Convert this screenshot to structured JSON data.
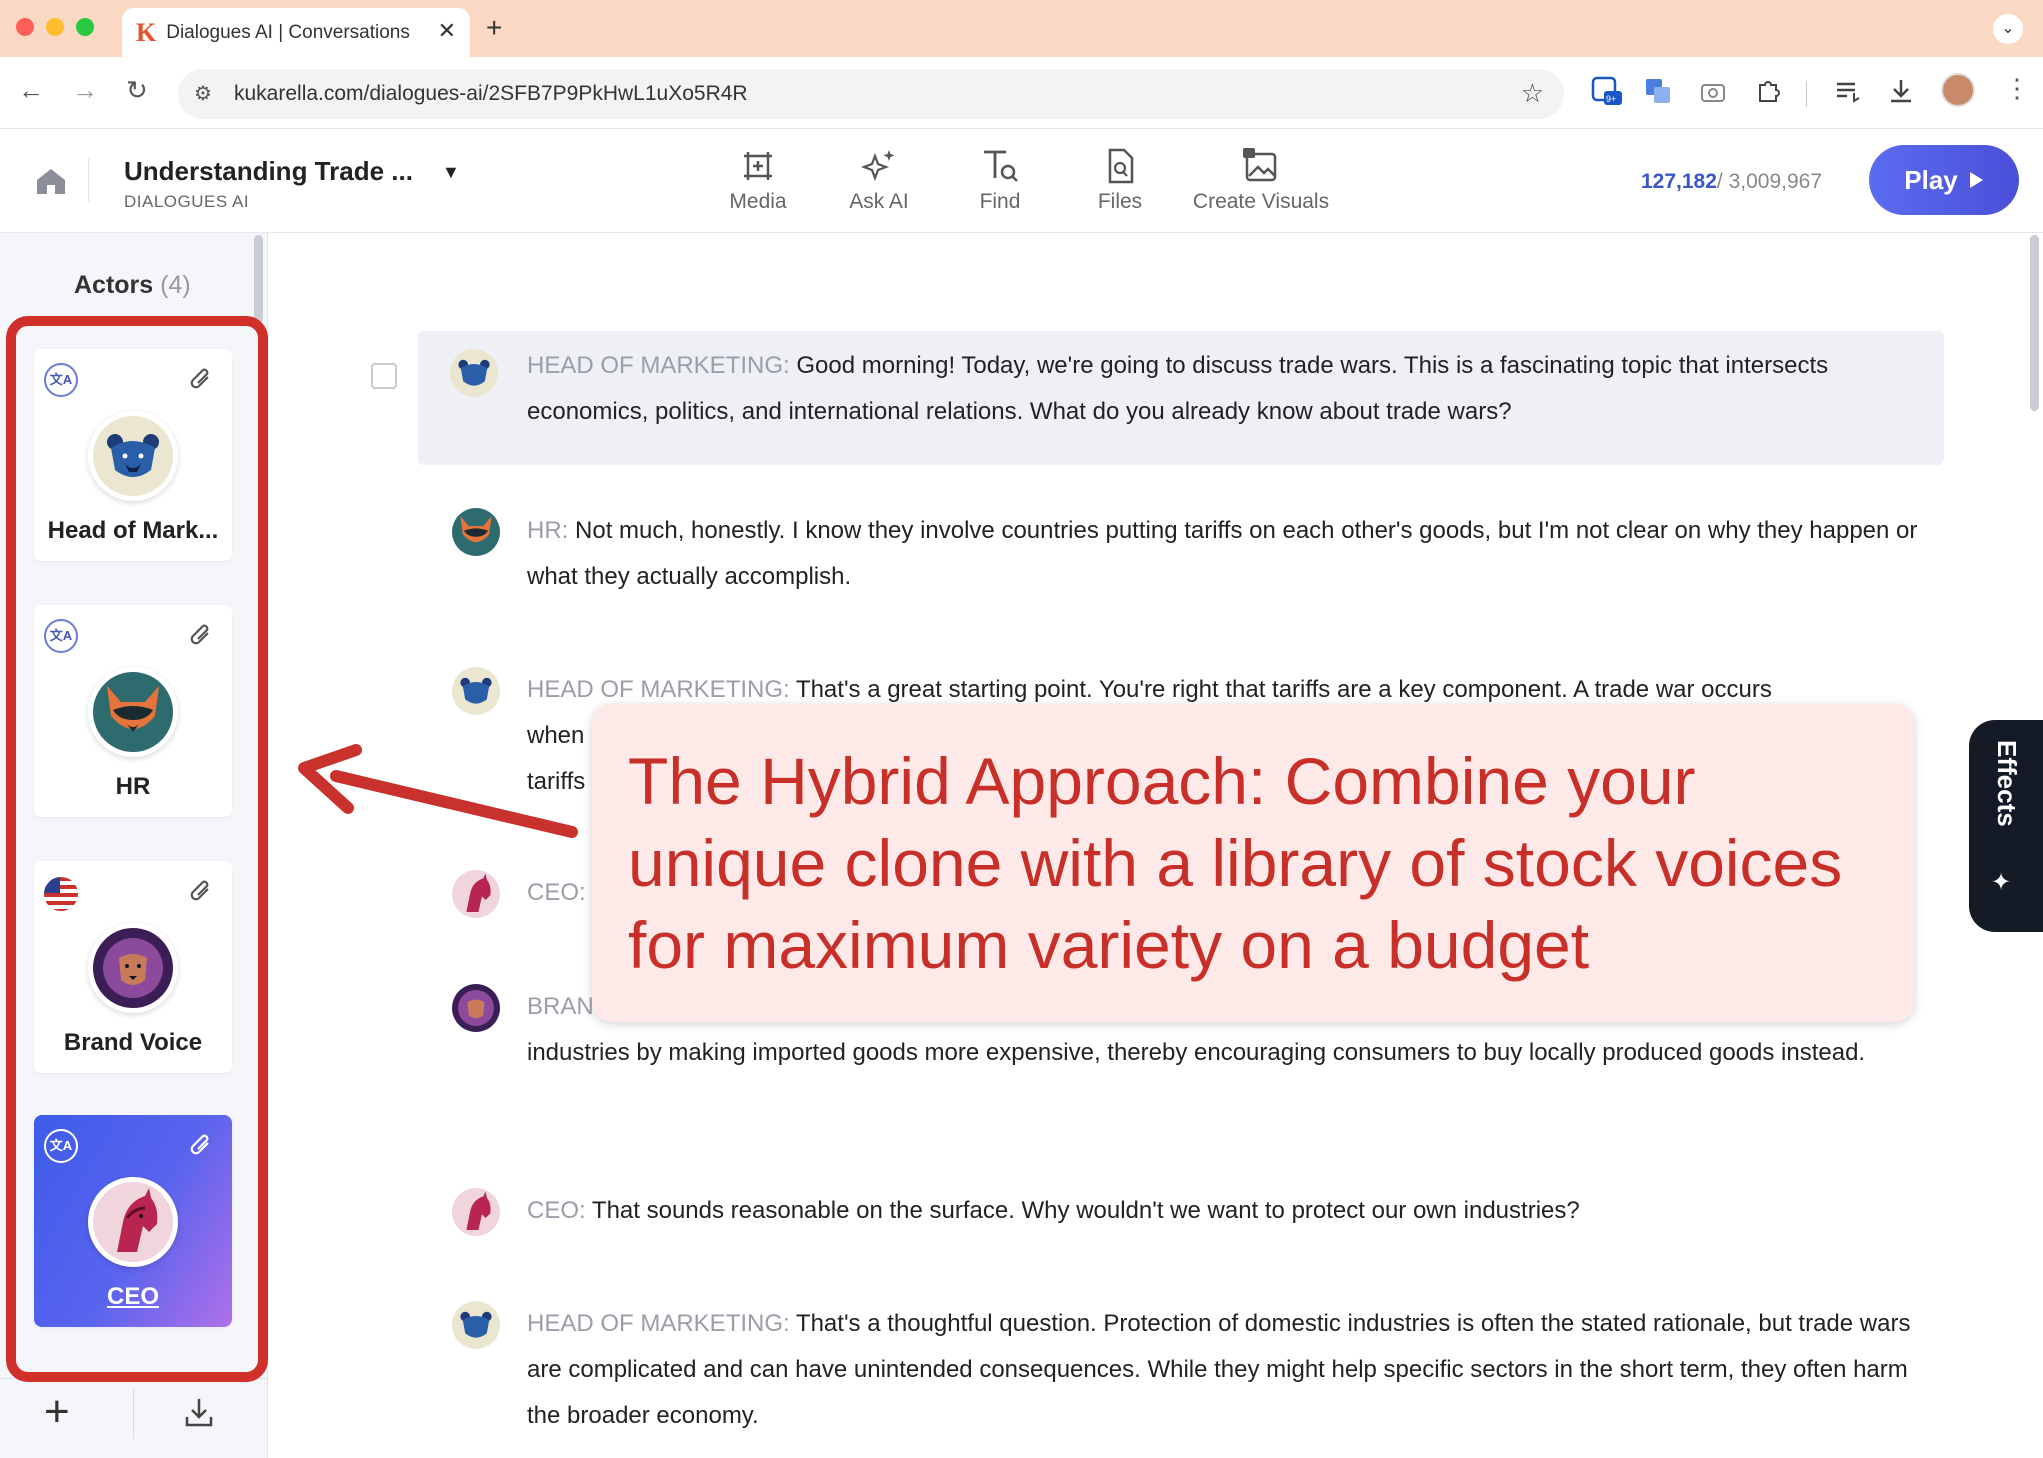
{
  "browser": {
    "tab_title": "Dialogues AI | Conversations",
    "tab_logo": "K",
    "tab_close": "✕",
    "new_tab": "+",
    "url": "kukarella.com/dialogues-ai/2SFB7P9PkHwL1uXo5R4R"
  },
  "header": {
    "title": "Understanding Trade ...",
    "subtitle": "DIALOGUES AI",
    "tools": {
      "media": "Media",
      "ask_ai": "Ask AI",
      "find": "Find",
      "files": "Files",
      "create_visuals": "Create Visuals"
    },
    "counter_used": "127,182",
    "counter_total": "/ 3,009,967",
    "play_label": "Play"
  },
  "sidebar": {
    "actors_label": "Actors",
    "actors_count": "(4)",
    "actors": [
      {
        "name": "Head of Mark...",
        "avatar_icon": "bear-icon",
        "lang_icon": "translate-icon"
      },
      {
        "name": "HR",
        "avatar_icon": "fox-icon",
        "lang_icon": "translate-icon"
      },
      {
        "name": "Brand Voice",
        "avatar_icon": "lion-icon",
        "lang_icon": "us-flag-icon"
      },
      {
        "name": "CEO",
        "avatar_icon": "horse-icon",
        "lang_icon": "translate-icon",
        "selected": true
      }
    ],
    "lang_glyph": "文A"
  },
  "conversation": [
    {
      "speaker": "HEAD OF MARKETING:",
      "text": "Good morning! Today, we're going to discuss trade wars. This is a fascinating topic that intersects economics, politics, and international relations. What do you already know about trade wars?"
    },
    {
      "speaker": "HR:",
      "text": "Not much, honestly. I know they involve countries putting tariffs on each other's goods, but I'm not clear on why they happen or what they actually accomplish."
    },
    {
      "speaker": "HEAD OF MARKETING:",
      "text": "That's a great starting point. You're right that tariffs are a key component. A trade war occurs"
    },
    {
      "speaker": "",
      "text": "when"
    },
    {
      "speaker": "",
      "text": "tariffs"
    },
    {
      "speaker": "CEO:",
      "text": ""
    },
    {
      "speaker": "BRAN",
      "text": ""
    },
    {
      "speaker": "",
      "text": "industries by making imported goods more expensive, thereby encouraging consumers to buy locally produced goods instead."
    },
    {
      "speaker": "CEO:",
      "text": "That sounds reasonable on the surface. Why wouldn't we want to protect our own industries?"
    },
    {
      "speaker": "HEAD OF MARKETING:",
      "text": "That's a thoughtful question. Protection of domestic industries is often the stated rationale, but trade wars are complicated and can have unintended consequences. While they might help specific sectors in the short term, they often harm the broader economy."
    }
  ],
  "callout_text": "The Hybrid Approach: Combine your unique clone with a library of stock voices for maximum variety on a budget",
  "effects_label": "Effects",
  "colors": {
    "accent": "#4a4fd8",
    "callout_text": "#c82f28",
    "highlight_box": "#d12f2a"
  }
}
